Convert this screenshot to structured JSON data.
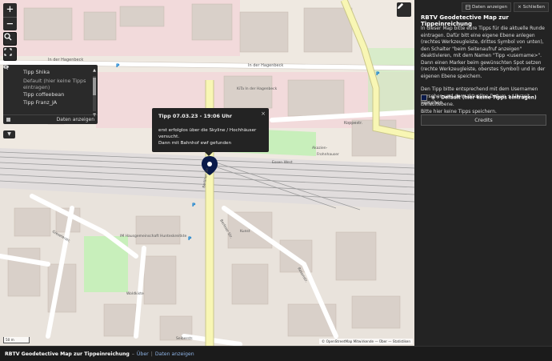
{
  "app": {
    "title": "RBTV Geodetective Map zur Tippeinreichung",
    "bottom_links": {
      "about": "Über",
      "show_data": "Daten anzeigen",
      "dash": "–",
      "pipe": "|"
    }
  },
  "map": {
    "zoom_in": "+",
    "zoom_out": "−",
    "layers": [
      {
        "label": "Tipp Shika",
        "visible": true
      },
      {
        "label": "Default (hier keine Tipps eintragen)",
        "visible": false
      },
      {
        "label": "Tipp coffeebean",
        "visible": true
      },
      {
        "label": "Tipp Franz_JA",
        "visible": true
      }
    ],
    "layers_footer_button": "Daten anzeigen",
    "popup": {
      "title": "Tipp 07.03.23 - 19:06 Uhr",
      "lines": [
        "erst erfolglos über die Skyline / Hochhäuser",
        "versucht.",
        "Dann mit Bahnhof ewf gefunden"
      ],
      "close": "×"
    },
    "attribution": "© OpenStreetMap Mitwirkende — Über — Statistiken",
    "scale": "50 m",
    "labels": {
      "street_top": "In der Hagenbeck",
      "street_top2": "In der Hagenbeck",
      "kita": "KiTa In der Hagenbeck",
      "street_kopp": "Koppestr.",
      "akazien": "Akazien-",
      "frohnhauser": "Frohnhauser",
      "essen_west": "Essen West",
      "berliner": "Berliner Str.",
      "berliner2": "Berliner Str.",
      "kunst": "Kunst",
      "iw_haus": "IM Hausgemeinschaft Hunteskreitkte",
      "gieselerstr": "Gieselerstr.",
      "seiberstr": "Seiberstr.",
      "woldkiste": "Woldkiste",
      "rosenstr": "Rosenstr.",
      "parkplatz": "P"
    },
    "colors": {
      "residential": "#efe9e1",
      "commercial": "#f2dadb",
      "rail": "#e0dede",
      "park": "#c8efbb",
      "road_major": "#f8f6b4"
    }
  },
  "sidebar": {
    "buttons": {
      "show_data": "Daten anzeigen",
      "close": "Schließen"
    },
    "title": "RBTV Geodetective Map zur Tippeinreichung",
    "paragraph1": "In dieser Map bitte eure Tipps für die aktuelle Runde eintragen. Dafür bitt eine eigene Ebene anlegen (rechtes Werkzeugleiste, drittes Symbol von unten), den Schalter \"beim Seitenaufruf anzeigen\" deaktivieren, mit dem Namen \"Tipp <username>\". Dann einen Marker beim gewünschten Spot setzen (rechte Werkzeugleiste, oberstes Symbol) und in der eigenen Ebene speichern.",
    "paragraph2": "Den Tipp bitte entsprechend mit dem Usernamen versehen und dem aktuellen Datum + Uhrzeit versehen.",
    "legend_bold": "Default (hier keine Tipps eintragen)",
    "legend_suffix": "Defaultebene.",
    "legend_line2": "Bitte hier keine Tipps speichern.",
    "credits_button": "Credits"
  }
}
